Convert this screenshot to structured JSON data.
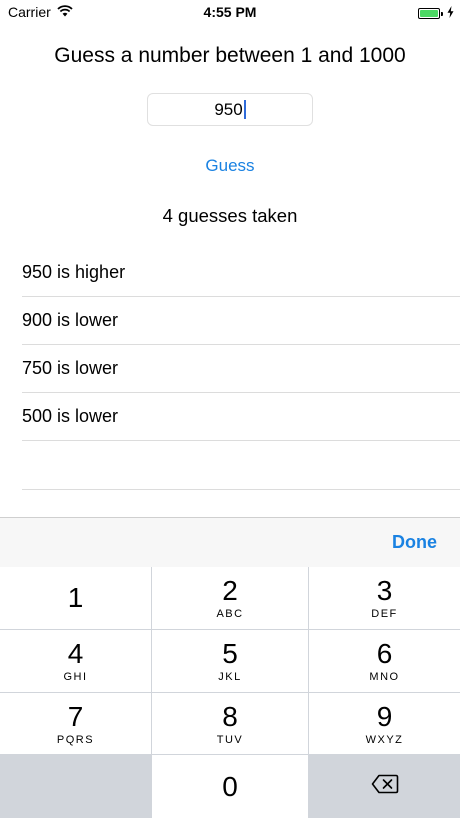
{
  "status_bar": {
    "carrier": "Carrier",
    "time": "4:55 PM",
    "battery_level": 1.0,
    "icons": [
      "wifi-icon",
      "battery-icon",
      "charging-bolt-icon"
    ]
  },
  "prompt": "Guess a number between 1 and 1000",
  "guess_input": {
    "value": "950"
  },
  "guess_button_label": "Guess",
  "guesses_count_text": "4 guesses taken",
  "history": [
    "950 is higher",
    "900 is lower",
    "750 is lower",
    "500 is lower"
  ],
  "keyboard": {
    "done_label": "Done",
    "keys": [
      {
        "digit": "1",
        "letters": ""
      },
      {
        "digit": "2",
        "letters": "ABC"
      },
      {
        "digit": "3",
        "letters": "DEF"
      },
      {
        "digit": "4",
        "letters": "GHI"
      },
      {
        "digit": "5",
        "letters": "JKL"
      },
      {
        "digit": "6",
        "letters": "MNO"
      },
      {
        "digit": "7",
        "letters": "PQRS"
      },
      {
        "digit": "8",
        "letters": "TUV"
      },
      {
        "digit": "9",
        "letters": "WXYZ"
      },
      {
        "digit": "0",
        "letters": ""
      }
    ],
    "delete_icon": "delete-backspace-icon"
  },
  "colors": {
    "accent": "#1a82e2",
    "battery": "#4cd964",
    "keyboard_background": "#d1d5db"
  }
}
